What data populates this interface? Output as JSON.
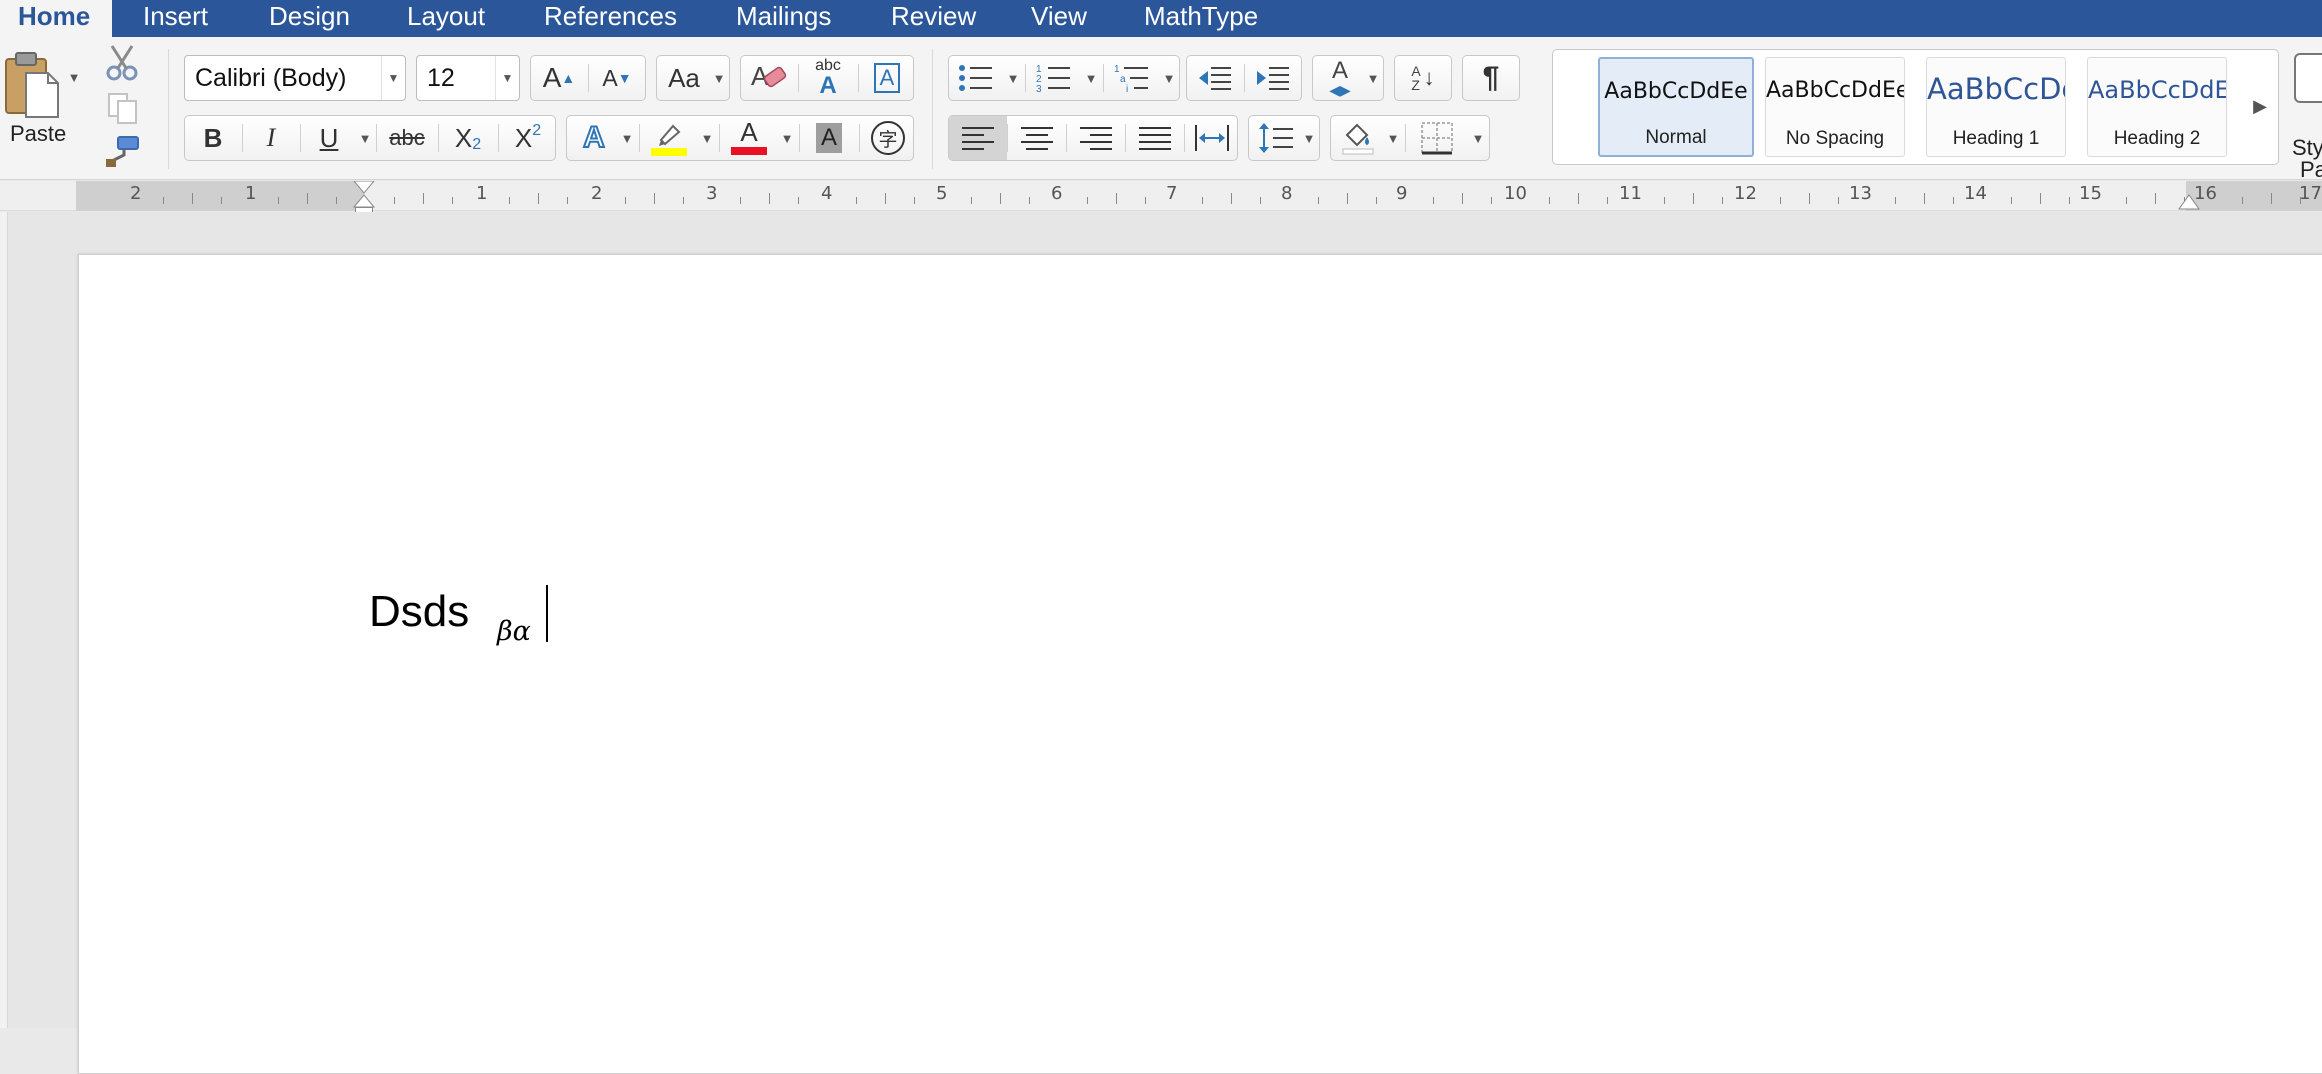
{
  "tabs": [
    {
      "label": "Home",
      "active": true
    },
    {
      "label": "Insert"
    },
    {
      "label": "Design"
    },
    {
      "label": "Layout"
    },
    {
      "label": "References"
    },
    {
      "label": "Mailings"
    },
    {
      "label": "Review"
    },
    {
      "label": "View"
    },
    {
      "label": "MathType"
    }
  ],
  "clipboard": {
    "paste_label": "Paste"
  },
  "font": {
    "name": "Calibri (Body)",
    "size": "12"
  },
  "font_buttons": {
    "grow": "A",
    "shrink": "A",
    "change_case": "Aa",
    "text_effects_label": "abc",
    "bold": "B",
    "italic": "I",
    "underline": "U",
    "strike": "abc",
    "subscript": "X",
    "subscript_digit": "2",
    "superscript": "X",
    "superscript_digit": "2",
    "font_color": "A",
    "shading": "A",
    "char_border": "A",
    "phonetic": "字"
  },
  "paragraph_buttons": {
    "pilcrow": "¶",
    "sort_a": "A",
    "sort_z": "Z"
  },
  "styles": [
    {
      "preview": "AaBbCcDdEe",
      "name": "Normal",
      "selected": true
    },
    {
      "preview": "AaBbCcDdEe",
      "name": "No Spacing"
    },
    {
      "preview": "AaBbCcDc",
      "name": "Heading 1"
    },
    {
      "preview": "AaBbCcDdEe",
      "name": "Heading 2"
    }
  ],
  "styles_pane_label": [
    "Sty",
    "Pa"
  ],
  "ruler_numbers": [
    "2",
    "1",
    "1",
    "2",
    "3",
    "4",
    "5",
    "6",
    "7",
    "8",
    "9",
    "10",
    "11",
    "12",
    "13",
    "14",
    "15",
    "16",
    "17"
  ],
  "document": {
    "text": "Dsds",
    "equation": "βα"
  },
  "colors": {
    "tabbar": "#2b579a",
    "highlight": "#ffff00",
    "font_color": "#e81123",
    "accent_blue": "#2e75b6"
  }
}
